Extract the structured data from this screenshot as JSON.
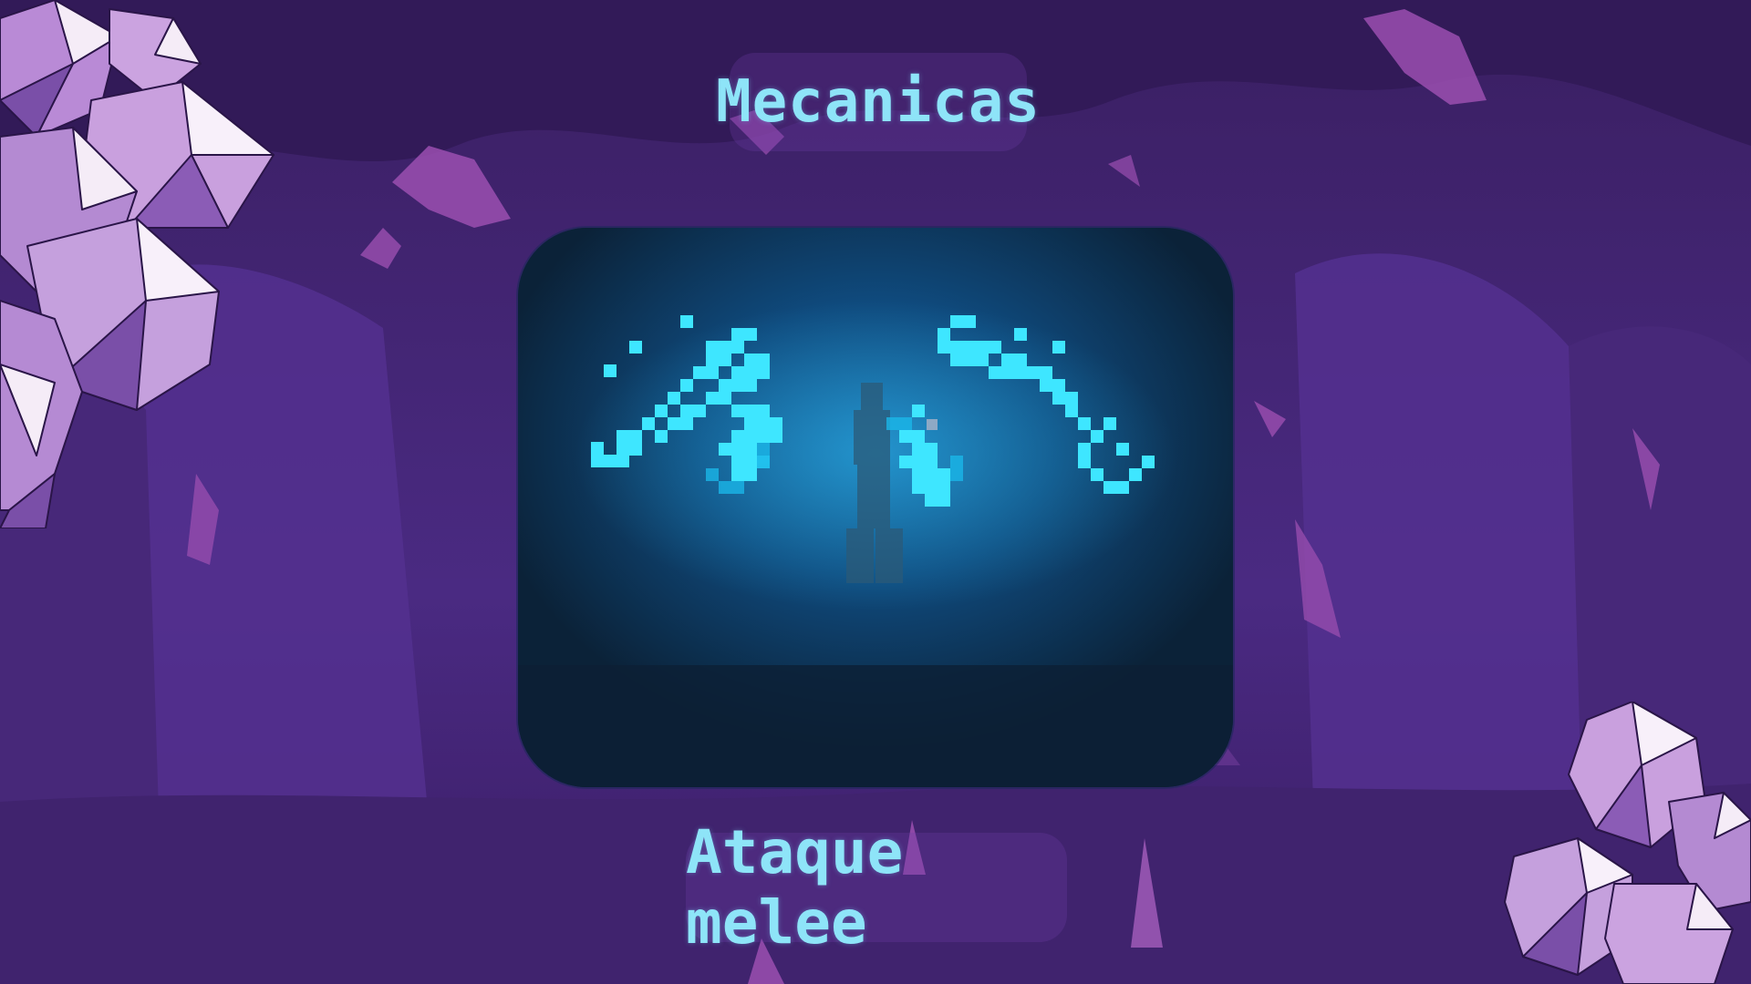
{
  "slide": {
    "title": "Mecanicas",
    "caption": "Ataque melee"
  },
  "theme": {
    "background": "#3c2068",
    "text_color": "#8ee4f8",
    "effect_color": "#2fe0ff"
  },
  "icons": {
    "top_left_decoration": "crystal-cluster-icon",
    "bottom_right_decoration": "crystal-cluster-icon",
    "attack_effect": "slash-wings-effect"
  }
}
